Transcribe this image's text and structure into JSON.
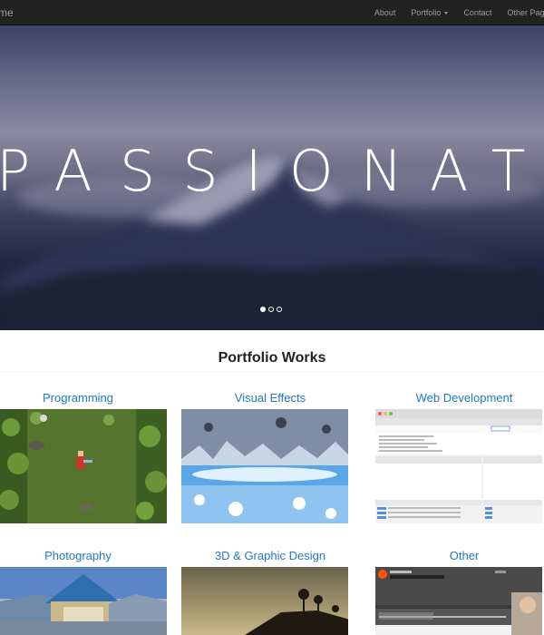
{
  "nav": {
    "brand": "me",
    "items": [
      {
        "label": "About"
      },
      {
        "label": "Portfolio"
      },
      {
        "label": "Contact"
      },
      {
        "label": "Other Pages"
      }
    ]
  },
  "hero": {
    "headline": "PASSIONATE",
    "slides_total": 3,
    "active_slide": 1
  },
  "portfolio": {
    "title": "Portfolio Works",
    "categories": [
      {
        "label": "Programming"
      },
      {
        "label": "Visual Effects"
      },
      {
        "label": "Web Development"
      },
      {
        "label": "Photography"
      },
      {
        "label": "3D & Graphic Design"
      },
      {
        "label": "Other"
      }
    ]
  },
  "colors": {
    "navbar": "#222222",
    "nav_text": "#9d9d9d",
    "link_blue": "#2378c7",
    "heading": "#222222"
  }
}
